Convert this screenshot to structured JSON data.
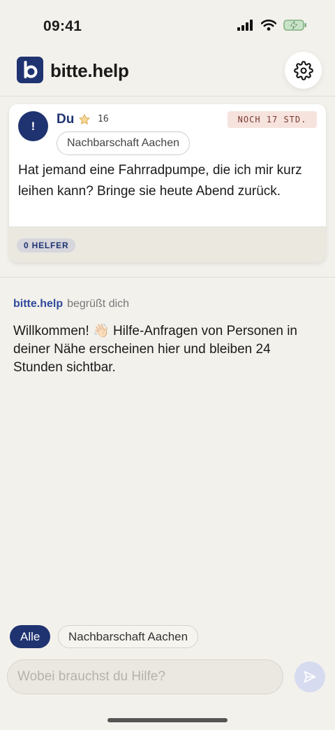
{
  "status_bar": {
    "time": "09:41"
  },
  "header": {
    "logo_letter": "b",
    "title": "bitte.help",
    "settings_icon": "gear-icon"
  },
  "request_card": {
    "avatar_symbol": "!",
    "author": "Du",
    "star_icon": "star-icon",
    "score": "16",
    "expiry": "NOCH 17 STD.",
    "location": "Nachbarschaft Aachen",
    "text": "Hat jemand eine Fahrradpumpe, die ich mir kurz leihen kann? Bringe sie heute Abend zurück.",
    "helpers_badge": "0 HELFER"
  },
  "welcome": {
    "brand": "bitte.help",
    "action": "begrüßt dich",
    "message": "Willkommen! 👋🏻 Hilfe-Anfragen von Personen in deiner Nähe erscheinen hier und bleiben 24 Stunden sichtbar."
  },
  "filters": {
    "all_label": "Alle",
    "location_label": "Nachbarschaft Aachen"
  },
  "composer": {
    "placeholder": "Wobei brauchst du Hilfe?",
    "value": "",
    "send_icon": "send-icon"
  },
  "colors": {
    "brand_navy": "#1f3371",
    "background": "#f3f1ec",
    "expiry_bg": "#f6e3de"
  }
}
